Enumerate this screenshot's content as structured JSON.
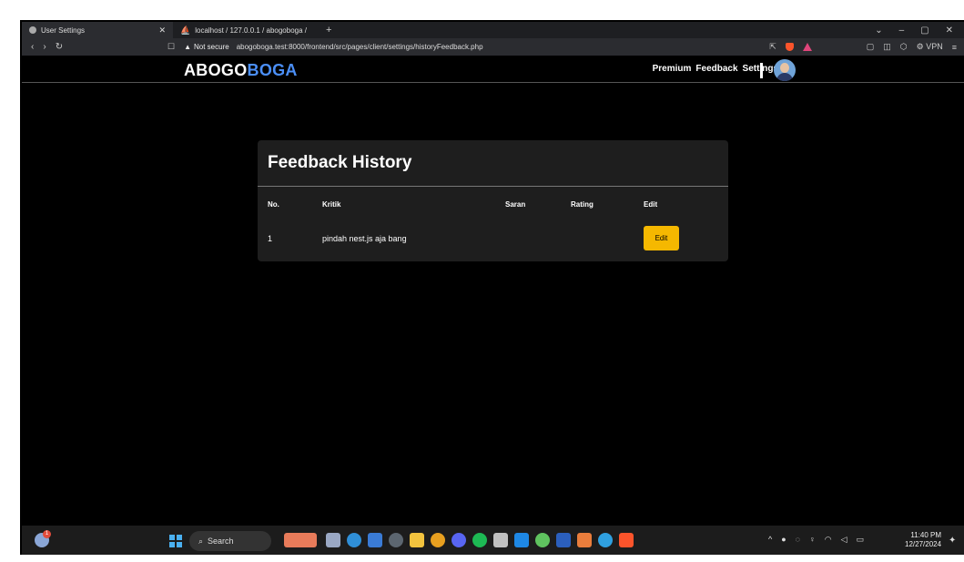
{
  "browser": {
    "tabs": [
      {
        "title": "User Settings",
        "active": true
      },
      {
        "title": "localhost / 127.0.0.1 / abogoboga /",
        "active": false
      }
    ],
    "new_tab_symbol": "+",
    "window_controls": [
      "⌄",
      "–",
      "▢",
      "✕"
    ],
    "security_label": "Not secure",
    "url": "abogoboga.test:8000/frontend/src/pages/client/settings/historyFeedback.php",
    "vpn_label": "VPN"
  },
  "site": {
    "logo_part1": "ABOGO",
    "logo_part2": "BOGA",
    "nav": [
      "Premium",
      "Feedback",
      "Settings"
    ],
    "brand_color": "#4b8ff7"
  },
  "history": {
    "title": "Feedback History",
    "columns": [
      "No.",
      "Kritik",
      "Saran",
      "Rating",
      "Edit"
    ],
    "rows": [
      {
        "no": "1",
        "kritik": "pindah nest.js aja bang",
        "saran": "",
        "rating": "",
        "edit_label": "Edit"
      }
    ],
    "edit_color": "#f5b800"
  },
  "taskbar": {
    "weather_badge": "1",
    "search_placeholder": "Search",
    "time": "11:40 PM",
    "date": "12/27/2024"
  }
}
